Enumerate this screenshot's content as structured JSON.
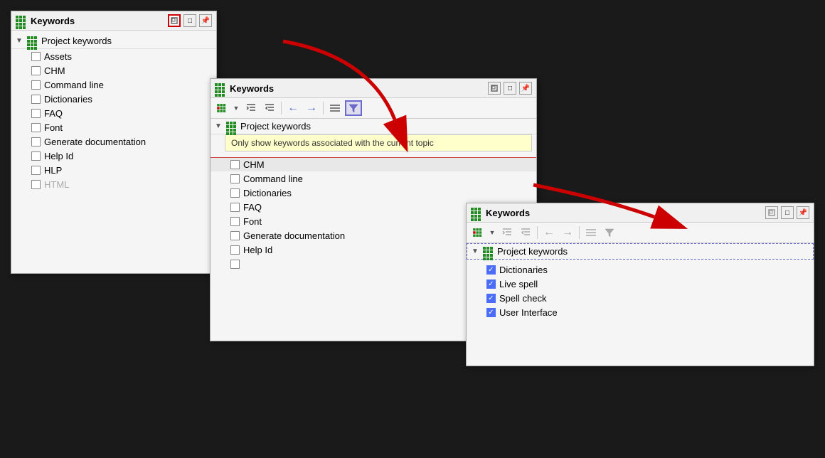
{
  "panel1": {
    "title": "Keywords",
    "section": "Project keywords",
    "items": [
      "Assets",
      "CHM",
      "Command line",
      "Dictionaries",
      "FAQ",
      "Font",
      "Generate documentation",
      "Help Id",
      "HLP",
      "HTML"
    ]
  },
  "panel2": {
    "title": "Keywords",
    "section": "Project keywords",
    "tooltip": "Only show keywords associated with the current topic",
    "items": [
      "CHM",
      "Command line",
      "Dictionaries",
      "FAQ",
      "Font",
      "Generate documentation",
      "Help Id"
    ]
  },
  "panel3": {
    "title": "Keywords",
    "section": "Project keywords",
    "checked_items": [
      "Dictionaries",
      "Live spell",
      "Spell check",
      "User Interface"
    ]
  },
  "arrows": {
    "arrow1_label": "→",
    "arrow2_label": "→"
  }
}
